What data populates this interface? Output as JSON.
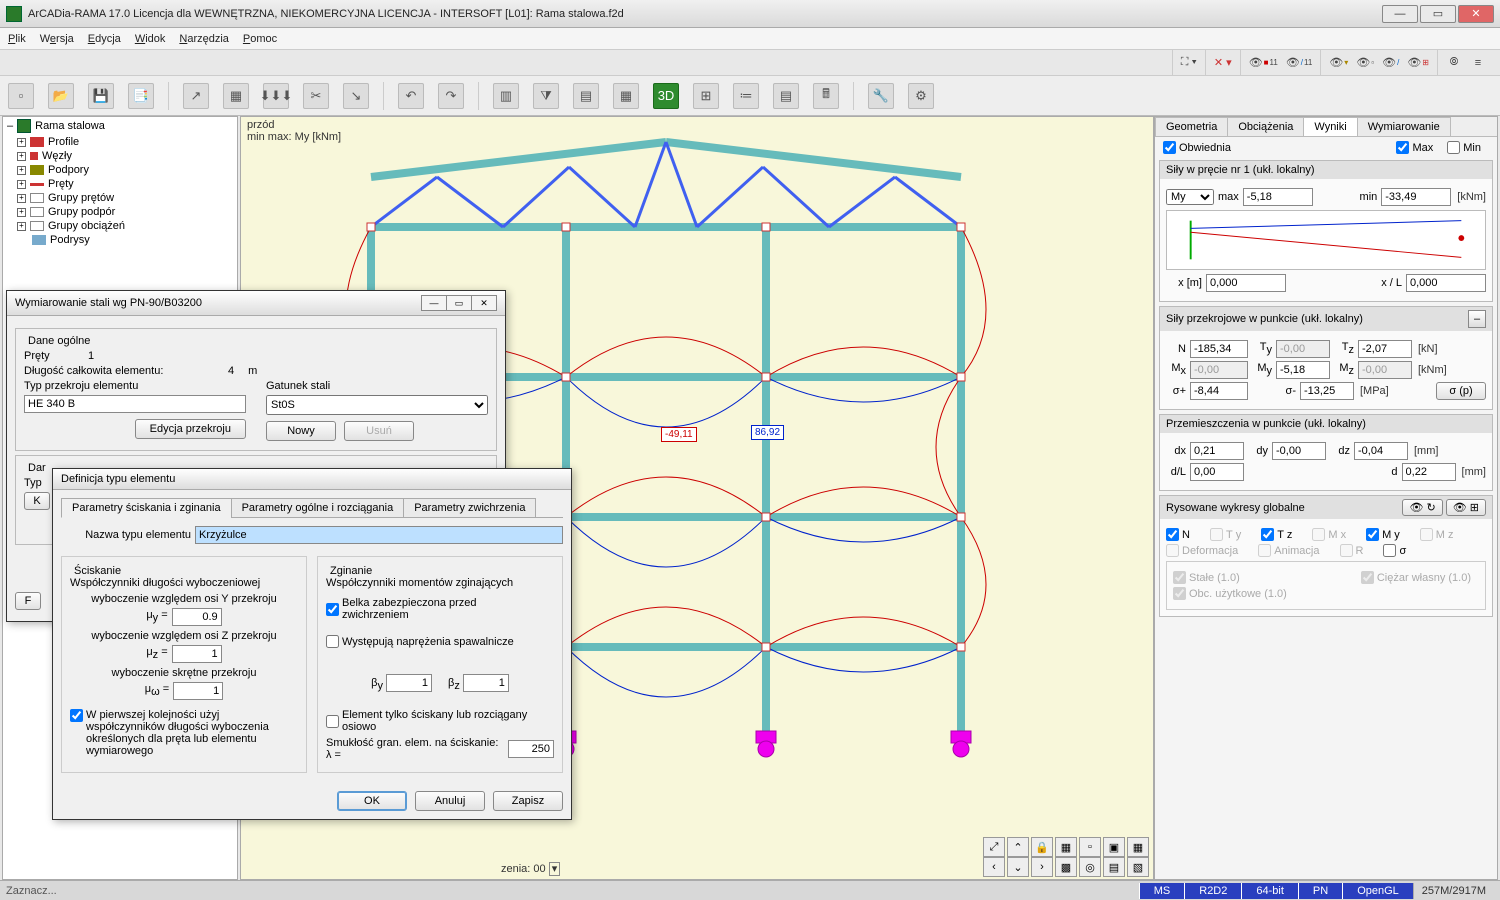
{
  "window": {
    "title": "ArCADia-RAMA 17.0 Licencja dla WEWNĘTRZNA, NIEKOMERCYJNA LICENCJA - INTERSOFT [L01]: Rama stalowa.f2d"
  },
  "menubar": [
    "Plik",
    "Wersja",
    "Edycja",
    "Widok",
    "Narzędzia",
    "Pomoc"
  ],
  "tree": {
    "root": "Rama stalowa",
    "items": [
      "Profile",
      "Węzły",
      "Podpory",
      "Pręty",
      "Grupy prętów",
      "Grupy podpór",
      "Grupy obciążeń",
      "Podrysy"
    ]
  },
  "canvas": {
    "view": "przód",
    "minmax": "min max: My [kNm]",
    "val_red": "-49,11",
    "val_blue": "86,92",
    "sel": "zenia: 00"
  },
  "rpanel": {
    "tabs": [
      "Geometria",
      "Obciążenia",
      "Wyniki",
      "Wymiarowanie"
    ],
    "active_tab": 2,
    "obwiednia": "Obwiednia",
    "max": "Max",
    "min": "Min",
    "sily": {
      "title": "Siły w pręcie nr 1 (ukł. lokalny)",
      "my": "My",
      "max_lbl": "max",
      "max_val": "-5,18",
      "min_lbl": "min",
      "min_val": "-33,49",
      "unit": "[kNm]",
      "xm": "x [m]",
      "xm_val": "0,000",
      "xl": "x / L",
      "xl_val": "0,000"
    },
    "przek": {
      "title": "Siły przekrojowe w punkcie (ukł. lokalny)",
      "N": "N",
      "N_v": "-185,34",
      "Ty": "T",
      "Ty_sub": "y",
      "Ty_v": "-0,00",
      "Tz": "T",
      "Tz_sub": "z",
      "Tz_v": "-2,07",
      "u1": "[kN]",
      "Mx": "M",
      "Mx_sub": "x",
      "Mx_v": "-0,00",
      "My": "M",
      "My_sub": "y",
      "My_v": "-5,18",
      "Mz": "M",
      "Mz_sub": "z",
      "Mz_v": "-0,00",
      "u2": "[kNm]",
      "sp": "σ+",
      "sp_v": "-8,44",
      "sm": "σ-",
      "sm_v": "-13,25",
      "u3": "[MPa]",
      "btn": "σ (p)"
    },
    "przem": {
      "title": "Przemieszczenia w punkcie (ukł. lokalny)",
      "dx": "dx",
      "dx_v": "0,21",
      "dy": "dy",
      "dy_v": "-0,00",
      "dz": "dz",
      "dz_v": "-0,04",
      "u1": "[mm]",
      "dL": "d/L",
      "dL_v": "0,00",
      "d": "d",
      "d_v": "0,22",
      "u2": "[mm]"
    },
    "wykresy": {
      "title": "Rysowane wykresy globalne",
      "opts": [
        "N",
        "T",
        "T",
        "M",
        "M",
        "M"
      ],
      "opts_sub": [
        "",
        "y",
        "z",
        "x",
        "y",
        "z"
      ],
      "checked": [
        true,
        false,
        true,
        false,
        true,
        false
      ],
      "enabled": [
        true,
        false,
        true,
        false,
        true,
        false
      ],
      "row2": [
        "Deformacja",
        "Animacja",
        "R",
        "σ"
      ],
      "row3a": "Stałe (1.0)",
      "row3b": "Ciężar własny (1.0)",
      "row4": "Obc. użytkowe (1.0)"
    }
  },
  "dlg1": {
    "title": "Wymiarowanie stali wg PN-90/B03200",
    "sec": "Dane ogólne",
    "prety": "Pręty",
    "prety_v": "1",
    "dlug": "Długość całkowita elementu:",
    "dlug_v": "4",
    "dlug_u": "m",
    "typ": "Typ przekroju elementu",
    "typ_v": "HE 340 B",
    "gat": "Gatunek stali",
    "gat_v": "St0S",
    "b1": "Edycja przekroju",
    "b2": "Nowy",
    "b3": "Usuń",
    "sec2_prefix": "Dar",
    "typ2": "Typ"
  },
  "dlg2": {
    "title": "Definicja typu elementu",
    "tabs": [
      "Parametry ściskania i zginania",
      "Parametry ogólne i rozciągania",
      "Parametry zwichrzenia"
    ],
    "nazwa": "Nazwa typu elementu",
    "nazwa_v": "Krzyżulce",
    "scisk": {
      "title": "Ściskanie",
      "line1": "Współczynniki długości wyboczeniowej",
      "wy": "wyboczenie względem osi Y przekroju",
      "muy": "μ",
      "muy_sub": "y",
      "muy_v": "0.9",
      "wz": "wyboczenie względem osi Z przekroju",
      "muz": "μ",
      "muz_sub": "z",
      "muz_v": "1",
      "ws": "wyboczenie skrętne przekroju",
      "muw": "μ",
      "muw_sub": "ω",
      "muw_v": "1",
      "chk": "W pierwszej kolejności użyj współczynników długości wyboczenia określonych dla pręta lub elementu wymiarowego"
    },
    "zgin": {
      "title": "Zginanie",
      "line1": "Współczynniki momentów zginających",
      "chk1": "Belka zabezpieczona przed zwichrzeniem",
      "chk2": "Występują naprężenia spawalnicze",
      "by": "β",
      "by_sub": "y",
      "by_v": "1",
      "bz": "β",
      "bz_sub": "z",
      "bz_v": "1"
    },
    "chk3": "Element tylko ściskany lub rozciągany osiowo",
    "smuk": "Smukłość gran. elem. na ściskanie:  λ =",
    "smuk_v": "250",
    "ok": "OK",
    "anuluj": "Anuluj",
    "zapisz": "Zapisz"
  },
  "status": {
    "left": "Zaznacz...",
    "cells": [
      "MS",
      "R2D2",
      "64-bit",
      "PN",
      "OpenGL"
    ],
    "mem": "257M/2917M"
  }
}
